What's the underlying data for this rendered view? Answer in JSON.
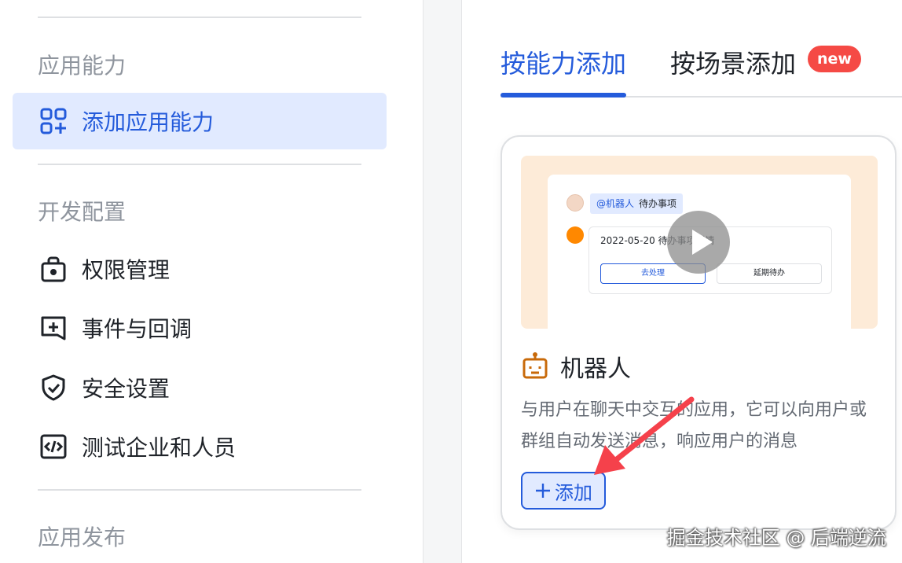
{
  "sidebar": {
    "sections": [
      {
        "title": "应用能力"
      },
      {
        "title": "开发配置"
      },
      {
        "title": "应用发布"
      }
    ],
    "items": [
      {
        "label": "添加应用能力",
        "icon": "grid-plus-icon",
        "active": true
      },
      {
        "label": "权限管理",
        "icon": "lock-bag-icon"
      },
      {
        "label": "事件与回调",
        "icon": "event-plus-icon"
      },
      {
        "label": "安全设置",
        "icon": "shield-check-icon"
      },
      {
        "label": "测试企业和人员",
        "icon": "code-icon"
      }
    ]
  },
  "tabs": [
    {
      "label": "按能力添加",
      "active": true
    },
    {
      "label": "按场景添加",
      "badge": "new"
    }
  ],
  "card": {
    "preview": {
      "mention": "@机器人",
      "task": "待办事项",
      "message_title": "2022-05-20 待办事项详情",
      "primary_action": "去处理",
      "secondary_action": "延期待办"
    },
    "title": "机器人",
    "icon": "robot-icon",
    "description": "与用户在聊天中交互的应用，它可以向用户或群组自动发送消息，响应用户的消息",
    "add_label": "添加"
  },
  "watermark": "掘金技术社区 @ 后端逆流",
  "colors": {
    "accent": "#245bdb",
    "active_bg": "#e1eaff",
    "badge": "#f54a45",
    "arrow": "#f5414b",
    "robot": "#c86a0a"
  }
}
